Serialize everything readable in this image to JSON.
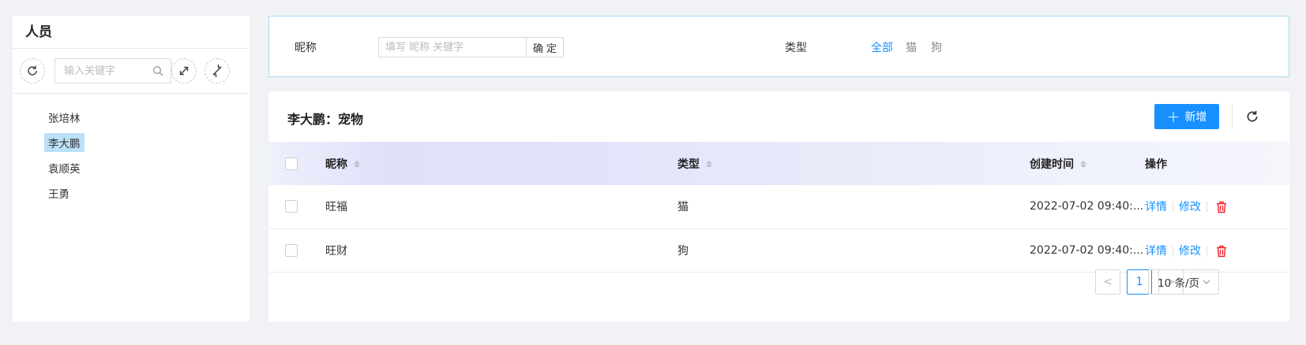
{
  "sidebar": {
    "title": "人员",
    "search_placeholder": "输入关键字",
    "people": [
      "张培林",
      "李大鹏",
      "袁顺英",
      "王勇"
    ],
    "selected": "李大鹏"
  },
  "filter": {
    "nickname_label": "昵称",
    "nickname_placeholder": "填写 昵称 关键字",
    "confirm_label": "确 定",
    "type_label": "类型",
    "type_options": [
      "全部",
      "猫",
      "狗"
    ],
    "type_selected": "全部"
  },
  "main": {
    "title": "李大鹏：宠物",
    "add_label": "新增",
    "columns": {
      "nickname": "昵称",
      "type": "类型",
      "created": "创建时间",
      "actions": "操作"
    },
    "rows": [
      {
        "nickname": "旺福",
        "type": "猫",
        "created": "2022-07-02 09:40:...",
        "detail": "详情",
        "edit": "修改"
      },
      {
        "nickname": "旺财",
        "type": "狗",
        "created": "2022-07-02 09:40:...",
        "detail": "详情",
        "edit": "修改"
      }
    ]
  },
  "pagination": {
    "prev": "<",
    "current_page": "1",
    "next": ">",
    "page_size": "10 条/页"
  },
  "colors": {
    "primary": "#1890ff",
    "danger": "#f5222d",
    "selected_bg": "#bae0f7"
  }
}
